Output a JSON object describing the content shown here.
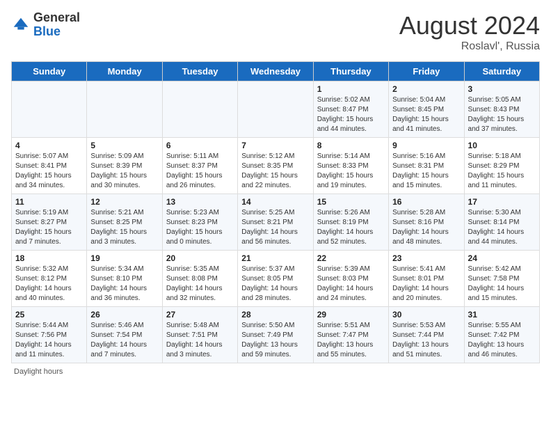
{
  "header": {
    "logo_general": "General",
    "logo_blue": "Blue",
    "month_year": "August 2024",
    "location": "Roslavl', Russia"
  },
  "footer": {
    "daylight_label": "Daylight hours"
  },
  "days_of_week": [
    "Sunday",
    "Monday",
    "Tuesday",
    "Wednesday",
    "Thursday",
    "Friday",
    "Saturday"
  ],
  "weeks": [
    [
      {
        "day": "",
        "sunrise": "",
        "sunset": "",
        "daylight": ""
      },
      {
        "day": "",
        "sunrise": "",
        "sunset": "",
        "daylight": ""
      },
      {
        "day": "",
        "sunrise": "",
        "sunset": "",
        "daylight": ""
      },
      {
        "day": "",
        "sunrise": "",
        "sunset": "",
        "daylight": ""
      },
      {
        "day": "1",
        "sunrise": "Sunrise: 5:02 AM",
        "sunset": "Sunset: 8:47 PM",
        "daylight": "Daylight: 15 hours and 44 minutes."
      },
      {
        "day": "2",
        "sunrise": "Sunrise: 5:04 AM",
        "sunset": "Sunset: 8:45 PM",
        "daylight": "Daylight: 15 hours and 41 minutes."
      },
      {
        "day": "3",
        "sunrise": "Sunrise: 5:05 AM",
        "sunset": "Sunset: 8:43 PM",
        "daylight": "Daylight: 15 hours and 37 minutes."
      }
    ],
    [
      {
        "day": "4",
        "sunrise": "Sunrise: 5:07 AM",
        "sunset": "Sunset: 8:41 PM",
        "daylight": "Daylight: 15 hours and 34 minutes."
      },
      {
        "day": "5",
        "sunrise": "Sunrise: 5:09 AM",
        "sunset": "Sunset: 8:39 PM",
        "daylight": "Daylight: 15 hours and 30 minutes."
      },
      {
        "day": "6",
        "sunrise": "Sunrise: 5:11 AM",
        "sunset": "Sunset: 8:37 PM",
        "daylight": "Daylight: 15 hours and 26 minutes."
      },
      {
        "day": "7",
        "sunrise": "Sunrise: 5:12 AM",
        "sunset": "Sunset: 8:35 PM",
        "daylight": "Daylight: 15 hours and 22 minutes."
      },
      {
        "day": "8",
        "sunrise": "Sunrise: 5:14 AM",
        "sunset": "Sunset: 8:33 PM",
        "daylight": "Daylight: 15 hours and 19 minutes."
      },
      {
        "day": "9",
        "sunrise": "Sunrise: 5:16 AM",
        "sunset": "Sunset: 8:31 PM",
        "daylight": "Daylight: 15 hours and 15 minutes."
      },
      {
        "day": "10",
        "sunrise": "Sunrise: 5:18 AM",
        "sunset": "Sunset: 8:29 PM",
        "daylight": "Daylight: 15 hours and 11 minutes."
      }
    ],
    [
      {
        "day": "11",
        "sunrise": "Sunrise: 5:19 AM",
        "sunset": "Sunset: 8:27 PM",
        "daylight": "Daylight: 15 hours and 7 minutes."
      },
      {
        "day": "12",
        "sunrise": "Sunrise: 5:21 AM",
        "sunset": "Sunset: 8:25 PM",
        "daylight": "Daylight: 15 hours and 3 minutes."
      },
      {
        "day": "13",
        "sunrise": "Sunrise: 5:23 AM",
        "sunset": "Sunset: 8:23 PM",
        "daylight": "Daylight: 15 hours and 0 minutes."
      },
      {
        "day": "14",
        "sunrise": "Sunrise: 5:25 AM",
        "sunset": "Sunset: 8:21 PM",
        "daylight": "Daylight: 14 hours and 56 minutes."
      },
      {
        "day": "15",
        "sunrise": "Sunrise: 5:26 AM",
        "sunset": "Sunset: 8:19 PM",
        "daylight": "Daylight: 14 hours and 52 minutes."
      },
      {
        "day": "16",
        "sunrise": "Sunrise: 5:28 AM",
        "sunset": "Sunset: 8:16 PM",
        "daylight": "Daylight: 14 hours and 48 minutes."
      },
      {
        "day": "17",
        "sunrise": "Sunrise: 5:30 AM",
        "sunset": "Sunset: 8:14 PM",
        "daylight": "Daylight: 14 hours and 44 minutes."
      }
    ],
    [
      {
        "day": "18",
        "sunrise": "Sunrise: 5:32 AM",
        "sunset": "Sunset: 8:12 PM",
        "daylight": "Daylight: 14 hours and 40 minutes."
      },
      {
        "day": "19",
        "sunrise": "Sunrise: 5:34 AM",
        "sunset": "Sunset: 8:10 PM",
        "daylight": "Daylight: 14 hours and 36 minutes."
      },
      {
        "day": "20",
        "sunrise": "Sunrise: 5:35 AM",
        "sunset": "Sunset: 8:08 PM",
        "daylight": "Daylight: 14 hours and 32 minutes."
      },
      {
        "day": "21",
        "sunrise": "Sunrise: 5:37 AM",
        "sunset": "Sunset: 8:05 PM",
        "daylight": "Daylight: 14 hours and 28 minutes."
      },
      {
        "day": "22",
        "sunrise": "Sunrise: 5:39 AM",
        "sunset": "Sunset: 8:03 PM",
        "daylight": "Daylight: 14 hours and 24 minutes."
      },
      {
        "day": "23",
        "sunrise": "Sunrise: 5:41 AM",
        "sunset": "Sunset: 8:01 PM",
        "daylight": "Daylight: 14 hours and 20 minutes."
      },
      {
        "day": "24",
        "sunrise": "Sunrise: 5:42 AM",
        "sunset": "Sunset: 7:58 PM",
        "daylight": "Daylight: 14 hours and 15 minutes."
      }
    ],
    [
      {
        "day": "25",
        "sunrise": "Sunrise: 5:44 AM",
        "sunset": "Sunset: 7:56 PM",
        "daylight": "Daylight: 14 hours and 11 minutes."
      },
      {
        "day": "26",
        "sunrise": "Sunrise: 5:46 AM",
        "sunset": "Sunset: 7:54 PM",
        "daylight": "Daylight: 14 hours and 7 minutes."
      },
      {
        "day": "27",
        "sunrise": "Sunrise: 5:48 AM",
        "sunset": "Sunset: 7:51 PM",
        "daylight": "Daylight: 14 hours and 3 minutes."
      },
      {
        "day": "28",
        "sunrise": "Sunrise: 5:50 AM",
        "sunset": "Sunset: 7:49 PM",
        "daylight": "Daylight: 13 hours and 59 minutes."
      },
      {
        "day": "29",
        "sunrise": "Sunrise: 5:51 AM",
        "sunset": "Sunset: 7:47 PM",
        "daylight": "Daylight: 13 hours and 55 minutes."
      },
      {
        "day": "30",
        "sunrise": "Sunrise: 5:53 AM",
        "sunset": "Sunset: 7:44 PM",
        "daylight": "Daylight: 13 hours and 51 minutes."
      },
      {
        "day": "31",
        "sunrise": "Sunrise: 5:55 AM",
        "sunset": "Sunset: 7:42 PM",
        "daylight": "Daylight: 13 hours and 46 minutes."
      }
    ]
  ]
}
